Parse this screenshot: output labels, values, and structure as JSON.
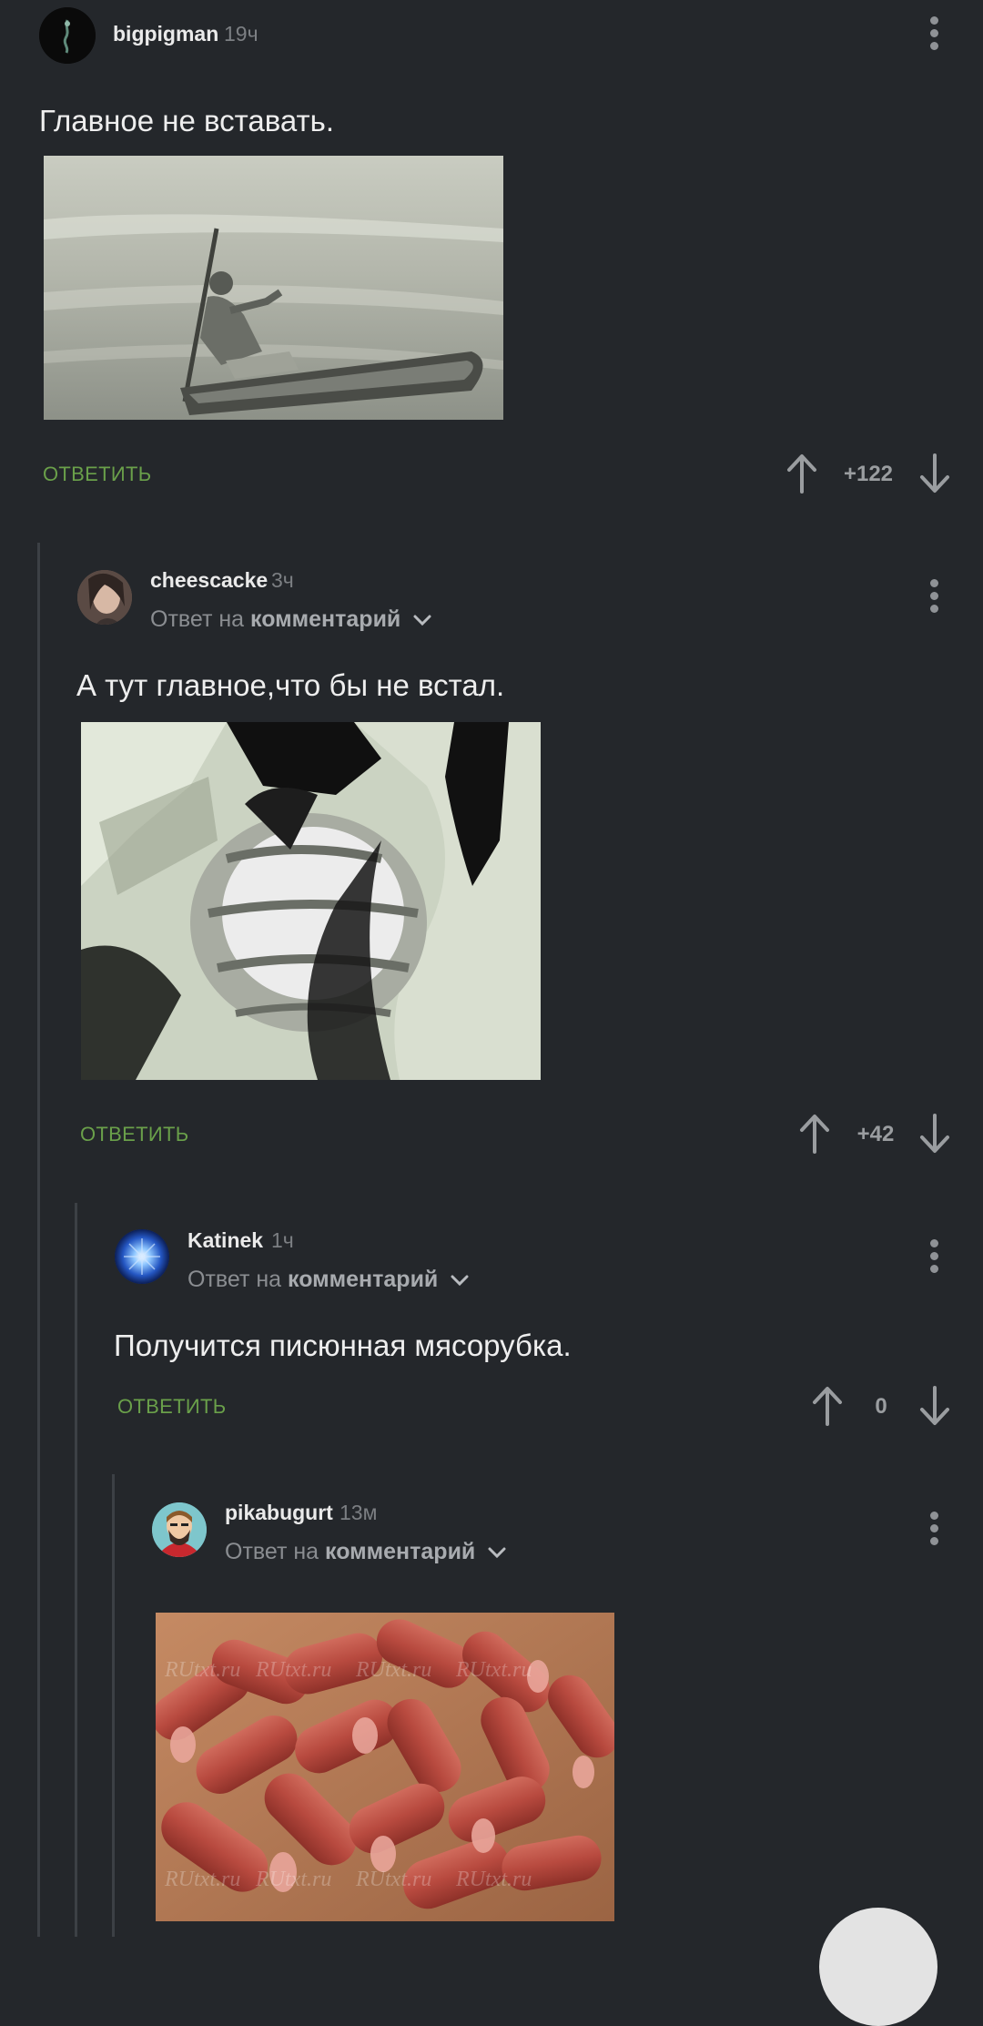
{
  "comments": [
    {
      "username": "bigpigman",
      "time": "19ч",
      "text": "Главное не вставать.",
      "reply_label": "ОТВЕТИТЬ",
      "score": "+122",
      "image_desc_icon": "boat-image"
    },
    {
      "username": "cheescacke",
      "time": "3ч",
      "reply_to_prefix": "Ответ на",
      "reply_to_link": "комментарий",
      "text": "А тут главное,что бы не встал.",
      "reply_label": "ОТВЕТИТЬ",
      "score": "+42"
    },
    {
      "username": "Katinek",
      "time": "1ч",
      "reply_to_prefix": "Ответ на",
      "reply_to_link": "комментарий",
      "text": "Получится писюнная мясорубка.",
      "reply_label": "ОТВЕТИТЬ",
      "score": "0"
    },
    {
      "username": "pikabugurt",
      "time": "13м",
      "reply_to_prefix": "Ответ на",
      "reply_to_link": "комментарий",
      "image_watermark": "RUtxt.ru"
    }
  ],
  "colors": {
    "background": "#24272b",
    "accent_green": "#6aa04a",
    "thread_line": "#3c4045"
  }
}
